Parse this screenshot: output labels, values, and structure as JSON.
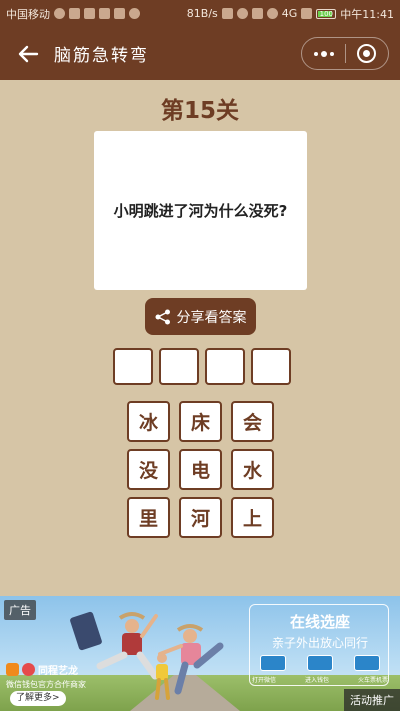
{
  "status_bar": {
    "carrier": "中国移动",
    "speed": "81B/s",
    "network": "4G",
    "battery": "100",
    "time": "中午11:41"
  },
  "titlebar": {
    "title": "脑筋急转弯"
  },
  "level": {
    "label": "第15关"
  },
  "question": {
    "text": "小明跳进了河为什么没死?"
  },
  "share_button": {
    "label": "分享看答案"
  },
  "answer_slots": [
    "",
    "",
    "",
    ""
  ],
  "letters": [
    "冰",
    "床",
    "会",
    "没",
    "电",
    "水",
    "里",
    "河",
    "上"
  ],
  "ad": {
    "badge": "广告",
    "panel_title": "在线选座",
    "panel_subtitle": "亲子外出放心同行",
    "step_labels": [
      "打开微信",
      "进入钱包",
      "火车票机票"
    ],
    "brand": "同程艺龙",
    "slogan": "微信钱包官方合作商家",
    "more": "了解更多>",
    "promo": "活动推广"
  },
  "colors": {
    "brand": "#6e3d24",
    "background": "#d6c5a6"
  }
}
